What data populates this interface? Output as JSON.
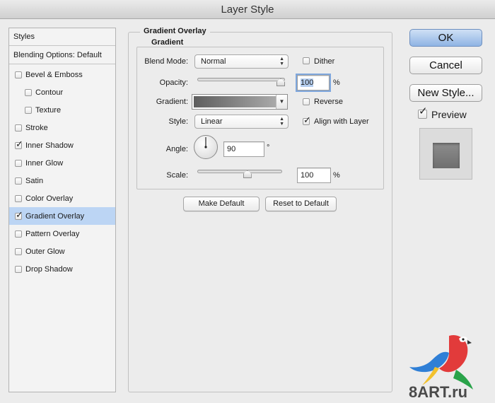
{
  "window": {
    "title": "Layer Style"
  },
  "sidebar": {
    "header": "Styles",
    "items": [
      {
        "label": "Blending Options: Default",
        "checkbox": false,
        "checked": false,
        "selected": false
      },
      {
        "label": "Bevel & Emboss",
        "checkbox": true,
        "checked": false,
        "selected": false
      },
      {
        "label": "Contour",
        "checkbox": true,
        "checked": false,
        "selected": false,
        "indent": true
      },
      {
        "label": "Texture",
        "checkbox": true,
        "checked": false,
        "selected": false,
        "indent": true
      },
      {
        "label": "Stroke",
        "checkbox": true,
        "checked": false,
        "selected": false
      },
      {
        "label": "Inner Shadow",
        "checkbox": true,
        "checked": true,
        "selected": false
      },
      {
        "label": "Inner Glow",
        "checkbox": true,
        "checked": false,
        "selected": false
      },
      {
        "label": "Satin",
        "checkbox": true,
        "checked": false,
        "selected": false
      },
      {
        "label": "Color Overlay",
        "checkbox": true,
        "checked": false,
        "selected": false
      },
      {
        "label": "Gradient Overlay",
        "checkbox": true,
        "checked": true,
        "selected": true
      },
      {
        "label": "Pattern Overlay",
        "checkbox": true,
        "checked": false,
        "selected": false
      },
      {
        "label": "Outer Glow",
        "checkbox": true,
        "checked": false,
        "selected": false
      },
      {
        "label": "Drop Shadow",
        "checkbox": true,
        "checked": false,
        "selected": false
      }
    ]
  },
  "panel": {
    "title": "Gradient Overlay",
    "group_title": "Gradient",
    "blend_mode": {
      "label": "Blend Mode:",
      "value": "Normal"
    },
    "dither": {
      "label": "Dither",
      "checked": false
    },
    "opacity": {
      "label": "Opacity:",
      "value": "100",
      "unit": "%",
      "level": 1.0
    },
    "gradient": {
      "label": "Gradient:",
      "from_color": "#5e5e5e",
      "to_color": "#a9a9a9"
    },
    "reverse": {
      "label": "Reverse",
      "checked": false
    },
    "style": {
      "label": "Style:",
      "value": "Linear"
    },
    "align_with_layer": {
      "label": "Align with Layer",
      "checked": true
    },
    "angle": {
      "label": "Angle:",
      "value": "90",
      "unit": "°"
    },
    "scale": {
      "label": "Scale:",
      "value": "100",
      "unit": "%",
      "level": 0.6
    },
    "make_default_label": "Make Default",
    "reset_default_label": "Reset to Default"
  },
  "actions": {
    "ok_label": "OK",
    "cancel_label": "Cancel",
    "new_style_label": "New Style...",
    "preview_label": "Preview",
    "preview_checked": true,
    "accent_color": "#8fb4e4"
  },
  "icons": {
    "checkmark": "check-icon",
    "popup_arrows": "chevron-updown-icon",
    "dropdown": "triangle-down-icon",
    "angle_dial": "angle-dial-icon"
  },
  "watermark": {
    "text": "8ART.ru"
  }
}
